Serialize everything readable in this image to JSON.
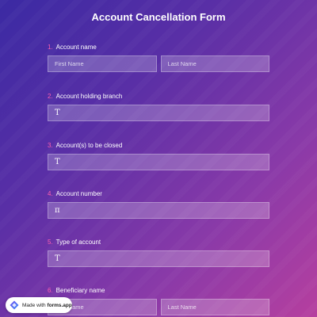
{
  "form": {
    "title": "Account Cancellation Form"
  },
  "questions": [
    {
      "number": "1.",
      "label": "Account name",
      "inputs": [
        {
          "placeholder": "First Name"
        },
        {
          "placeholder": "Last Name"
        }
      ]
    },
    {
      "number": "2.",
      "label": "Account holding branch",
      "icon": "T"
    },
    {
      "number": "3.",
      "label": "Account(s) to be closed",
      "icon": "T"
    },
    {
      "number": "4.",
      "label": "Account number",
      "icon": "π"
    },
    {
      "number": "5.",
      "label": "Type of account",
      "icon": "T"
    },
    {
      "number": "6.",
      "label": "Beneficiary name",
      "inputs": [
        {
          "placeholder": "First Name"
        },
        {
          "placeholder": "Last Name"
        }
      ]
    }
  ],
  "badge": {
    "prefix": "Made with ",
    "brand": "forms.app",
    "icon": "forms-app-logo-icon"
  },
  "colors": {
    "gradient_start": "#3b2aa3",
    "gradient_end": "#b63f9f",
    "number_accent": "#ff5fb0"
  }
}
